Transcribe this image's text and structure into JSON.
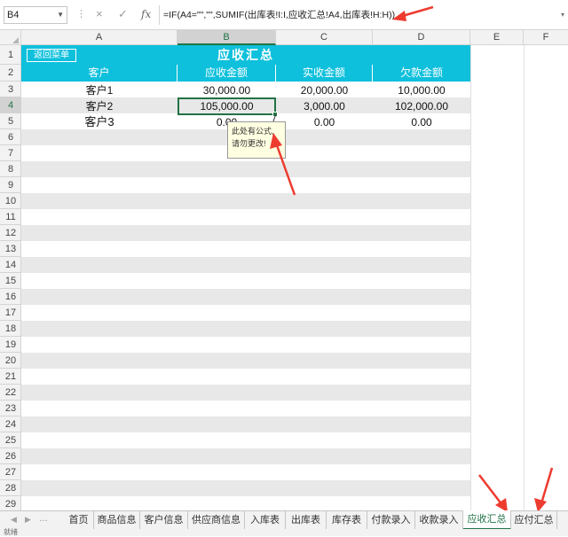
{
  "formula_bar": {
    "name_box": "B4",
    "formula": "=IF(A4=\"\",\"\",SUMIF(出库表!I:I,应收汇总!A4,出库表!H:H))",
    "cancel_icon": "×",
    "enter_icon": "✓",
    "fx_icon": "fx"
  },
  "columns": [
    "A",
    "B",
    "C",
    "D",
    "E",
    "F"
  ],
  "rows": [
    "1",
    "2",
    "3",
    "4",
    "5",
    "6",
    "7",
    "8",
    "9",
    "10",
    "11",
    "12",
    "13",
    "14",
    "15",
    "16",
    "17",
    "18",
    "19",
    "20",
    "21",
    "22",
    "23",
    "24",
    "25",
    "26",
    "27",
    "28",
    "29"
  ],
  "sheet": {
    "back_button": "返回菜单",
    "title": "应收汇总",
    "headers": [
      "客户",
      "应收金额",
      "实收金额",
      "欠款金额"
    ],
    "data_rows": [
      [
        "客户1",
        "30,000.00",
        "20,000.00",
        "10,000.00"
      ],
      [
        "客户2",
        "105,000.00",
        "3,000.00",
        "102,000.00"
      ],
      [
        "客户3",
        "0.00",
        "0.00",
        "0.00"
      ]
    ],
    "comment": "此处有公式,请勿更改!"
  },
  "tabs": [
    "首页",
    "商品信息",
    "客户信息",
    "供应商信息",
    "入库表",
    "出库表",
    "库存表",
    "付款录入",
    "收款录入",
    "应收汇总",
    "应付汇总"
  ],
  "active_tab": "应收汇总",
  "status": "就绪",
  "colors": {
    "accent": "#0ec0dc",
    "selection": "#217346",
    "arrow": "#ee3b2f"
  }
}
